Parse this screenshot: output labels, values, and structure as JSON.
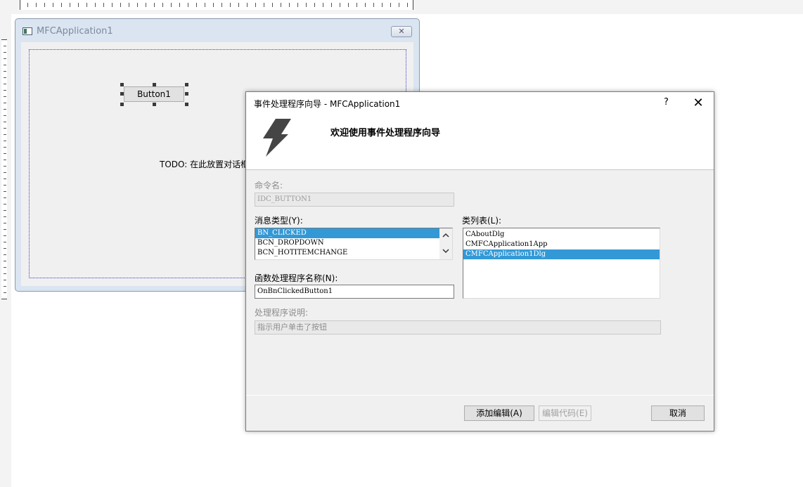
{
  "background_window": {
    "title": "MFCApplication1",
    "close_glyph": "✕",
    "design_button_label": "Button1",
    "todo_text": "TODO: 在此放置对话框"
  },
  "wizard": {
    "title": "事件处理程序向导 - MFCApplication1",
    "help_glyph": "?",
    "close_glyph": "✕",
    "icon": "lightning-bolt-icon",
    "heading": "欢迎使用事件处理程序向导",
    "command_name_label": "命令名:",
    "command_name_value": "IDC_BUTTON1",
    "message_type_label": "消息类型(Y):",
    "message_types": [
      "BN_CLICKED",
      "BCN_DROPDOWN",
      "BCN_HOTITEMCHANGE"
    ],
    "selected_message_type": "BN_CLICKED",
    "class_list_label": "类列表(L):",
    "classes": [
      "CAboutDlg",
      "CMFCApplication1App",
      "CMFCApplication1Dlg"
    ],
    "selected_class": "CMFCApplication1Dlg",
    "function_name_label": "函数处理程序名称(N):",
    "function_name_value": "OnBnClickedButton1",
    "handler_desc_label": "处理程序说明:",
    "handler_desc_value": "指示用户单击了按钮",
    "add_edit_button": "添加编辑(A)",
    "edit_code_button": "编辑代码(E)",
    "cancel_button": "取消"
  },
  "colors": {
    "selection": "#3399d6",
    "mfc_frame": "#dbe5f1"
  }
}
